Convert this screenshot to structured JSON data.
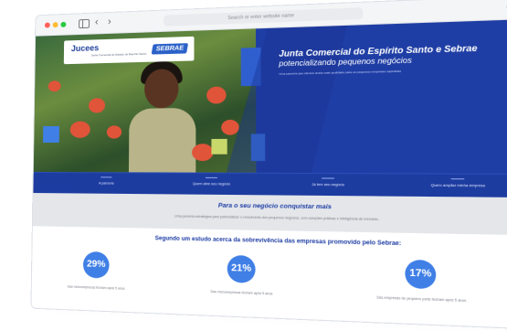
{
  "browser": {
    "url_placeholder": "Search or enter website name",
    "back_glyph": "‹",
    "forward_glyph": "›",
    "new_tab_glyph": "+"
  },
  "hero": {
    "logo_text": "Jucees",
    "logo_subtext": "Junta Comercial do Estado do Espírito Santo",
    "partner_logo_text": "SEBRAE",
    "title": "Junta Comercial do Espírito Santo e Sebrae",
    "subtitle": "potencializando pequenos negócios",
    "description": "Uma parceria que oferece ainda mais qualidade para os pequenos empresas capixabas"
  },
  "nav_items": [
    "A parceria",
    "Quem abre seu negócio",
    "Já tem seu negócio",
    "Quero ampliar minha empresa"
  ],
  "info_band": {
    "title": "Para o seu negócio conquistar mais",
    "text": "Uma parceria estratégica para potencializar o crescimento dos pequenos negócios, com soluções práticas e inteligência de mercado."
  },
  "study": {
    "title": "Segundo um estudo acerca da sobrevivência das empresas promovido pelo Sebrae:",
    "stats": [
      {
        "value": "29%",
        "label": "Das microempresas fecham após 5 anos"
      },
      {
        "value": "21%",
        "label": "Das microempresas fecham após 5 anos"
      },
      {
        "value": "17%",
        "label": "Das empresas de pequeno porte fecham após 5 anos"
      }
    ]
  },
  "colors": {
    "brand_blue": "#1f3ea5",
    "accent_blue": "#3f7fe6",
    "band_gray": "#e4e6ea"
  }
}
